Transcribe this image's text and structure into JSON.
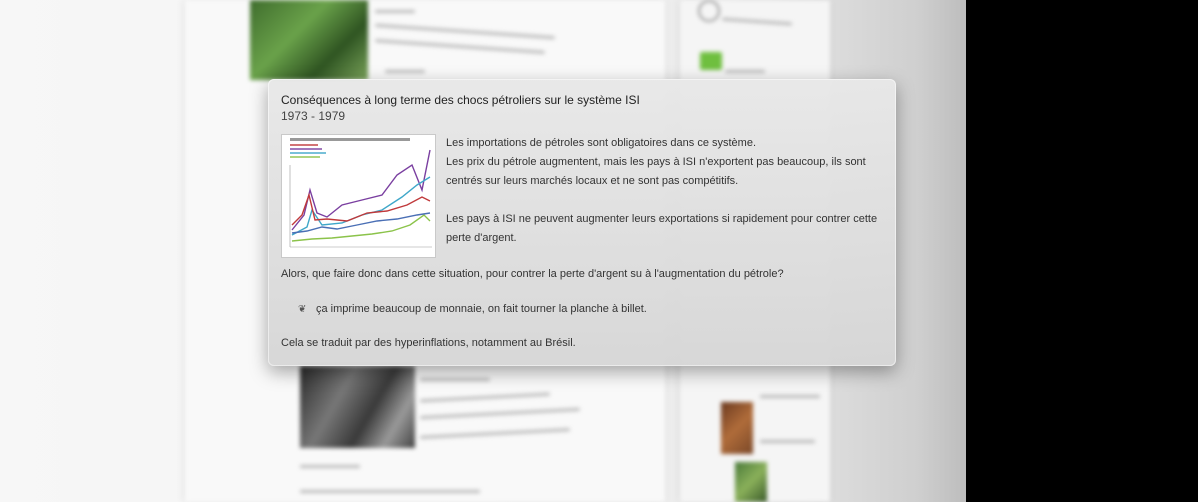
{
  "popup": {
    "title": "Conséquences à long terme des chocs pétroliers sur le système ISI",
    "years": "1973 - 1979",
    "paragraphs": [
      "Les importations de pétroles sont obligatoires dans ce système.",
      "Les prix du pétrole augmentent, mais les pays à ISI n'exportent pas beaucoup, ils sont centrés sur leurs marchés locaux et ne sont pas compétitifs.",
      "Les pays à ISI ne peuvent augmenter leurs exportations si rapidement pour contrer cette perte d'argent."
    ],
    "question": "Alors, que faire donc dans cette situation, pour contrer la perte d'argent su à l'augmentation du pétrole?",
    "bullet_icon": "leaf-bullet-icon",
    "bullet": "ça imprime beaucoup de monnaie, on fait tourner la planche à billet.",
    "closing": "Cela se traduit par des hyperinflations, notamment au Brésil."
  },
  "thumbnail_chart": {
    "type": "line",
    "series_colors": [
      "#7a3fa0",
      "#3fa7c9",
      "#c0393b",
      "#8bc34a",
      "#4a6fb5"
    ]
  }
}
